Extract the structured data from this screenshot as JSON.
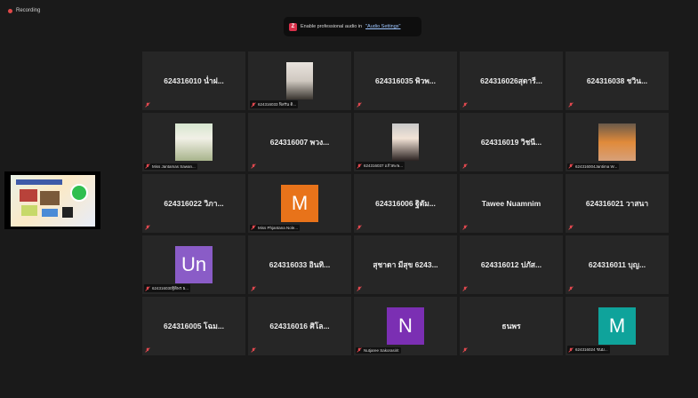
{
  "recording": {
    "label": "Recording"
  },
  "banner": {
    "text": "Enable professional audio in",
    "link": "\"Audio Settings\""
  },
  "share": {
    "label": "Shared screen"
  },
  "tiles": [
    {
      "name": "624316010 น่ำฝ...",
      "type": "name"
    },
    {
      "name": "624316033 ฟิสรัน ดิ...",
      "type": "photo",
      "photo": "photo-1"
    },
    {
      "name": "624316035 พิวพ...",
      "type": "name"
    },
    {
      "name": "624316026สุดารี...",
      "type": "name"
    },
    {
      "name": "624316038 ชวิน...",
      "type": "name"
    },
    {
      "name": "Miss Jantamas Sawan...",
      "type": "photo",
      "photo": "photo-2"
    },
    {
      "name": "624316007 พวง...",
      "type": "name"
    },
    {
      "name": "624316037 แก้วตะพ...",
      "type": "photo",
      "photo": "photo-3"
    },
    {
      "name": "624316019 วิชนี...",
      "type": "name"
    },
    {
      "name": "624316004Jantima W...",
      "type": "photo",
      "photo": "photo-4"
    },
    {
      "name": "624316022 วิภา...",
      "type": "name"
    },
    {
      "name": "Miss Phjantana Nole...",
      "type": "initial",
      "initial": "M",
      "color": "#e8731a"
    },
    {
      "name": "624316006 ฐิตัม...",
      "type": "name"
    },
    {
      "name": "Tawee Nuamnim",
      "type": "name"
    },
    {
      "name": "624316021 วาสนา",
      "type": "name"
    },
    {
      "name": "624316030ฐิติพร ธ...",
      "type": "initial",
      "initial": "Un",
      "color": "#8a5cc7"
    },
    {
      "name": "624316033 อินทิ...",
      "type": "name"
    },
    {
      "name": "สุชาดา มีสุข 6243...",
      "type": "name"
    },
    {
      "name": "624316012 ปภัส...",
      "type": "name"
    },
    {
      "name": "624316011 บุญ...",
      "type": "name"
    },
    {
      "name": "624316005 โฉม...",
      "type": "name"
    },
    {
      "name": "624316016 ศิโล...",
      "type": "name"
    },
    {
      "name": "Nutjaree Sakorasirit",
      "type": "initial",
      "initial": "N",
      "color": "#7b2fb3"
    },
    {
      "name": "ธนพร",
      "type": "name"
    },
    {
      "name": "624316024 ชนม...",
      "type": "initial",
      "initial": "M",
      "color": "#0fa39b"
    }
  ]
}
